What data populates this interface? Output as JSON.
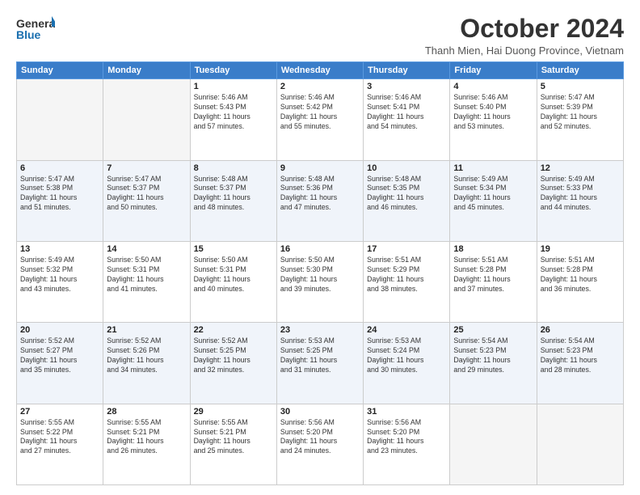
{
  "logo": {
    "line1": "General",
    "line2": "Blue"
  },
  "title": "October 2024",
  "subtitle": "Thanh Mien, Hai Duong Province, Vietnam",
  "days_of_week": [
    "Sunday",
    "Monday",
    "Tuesday",
    "Wednesday",
    "Thursday",
    "Friday",
    "Saturday"
  ],
  "weeks": [
    [
      {
        "day": "",
        "info": ""
      },
      {
        "day": "",
        "info": ""
      },
      {
        "day": "1",
        "info": "Sunrise: 5:46 AM\nSunset: 5:43 PM\nDaylight: 11 hours\nand 57 minutes."
      },
      {
        "day": "2",
        "info": "Sunrise: 5:46 AM\nSunset: 5:42 PM\nDaylight: 11 hours\nand 55 minutes."
      },
      {
        "day": "3",
        "info": "Sunrise: 5:46 AM\nSunset: 5:41 PM\nDaylight: 11 hours\nand 54 minutes."
      },
      {
        "day": "4",
        "info": "Sunrise: 5:46 AM\nSunset: 5:40 PM\nDaylight: 11 hours\nand 53 minutes."
      },
      {
        "day": "5",
        "info": "Sunrise: 5:47 AM\nSunset: 5:39 PM\nDaylight: 11 hours\nand 52 minutes."
      }
    ],
    [
      {
        "day": "6",
        "info": "Sunrise: 5:47 AM\nSunset: 5:38 PM\nDaylight: 11 hours\nand 51 minutes."
      },
      {
        "day": "7",
        "info": "Sunrise: 5:47 AM\nSunset: 5:37 PM\nDaylight: 11 hours\nand 50 minutes."
      },
      {
        "day": "8",
        "info": "Sunrise: 5:48 AM\nSunset: 5:37 PM\nDaylight: 11 hours\nand 48 minutes."
      },
      {
        "day": "9",
        "info": "Sunrise: 5:48 AM\nSunset: 5:36 PM\nDaylight: 11 hours\nand 47 minutes."
      },
      {
        "day": "10",
        "info": "Sunrise: 5:48 AM\nSunset: 5:35 PM\nDaylight: 11 hours\nand 46 minutes."
      },
      {
        "day": "11",
        "info": "Sunrise: 5:49 AM\nSunset: 5:34 PM\nDaylight: 11 hours\nand 45 minutes."
      },
      {
        "day": "12",
        "info": "Sunrise: 5:49 AM\nSunset: 5:33 PM\nDaylight: 11 hours\nand 44 minutes."
      }
    ],
    [
      {
        "day": "13",
        "info": "Sunrise: 5:49 AM\nSunset: 5:32 PM\nDaylight: 11 hours\nand 43 minutes."
      },
      {
        "day": "14",
        "info": "Sunrise: 5:50 AM\nSunset: 5:31 PM\nDaylight: 11 hours\nand 41 minutes."
      },
      {
        "day": "15",
        "info": "Sunrise: 5:50 AM\nSunset: 5:31 PM\nDaylight: 11 hours\nand 40 minutes."
      },
      {
        "day": "16",
        "info": "Sunrise: 5:50 AM\nSunset: 5:30 PM\nDaylight: 11 hours\nand 39 minutes."
      },
      {
        "day": "17",
        "info": "Sunrise: 5:51 AM\nSunset: 5:29 PM\nDaylight: 11 hours\nand 38 minutes."
      },
      {
        "day": "18",
        "info": "Sunrise: 5:51 AM\nSunset: 5:28 PM\nDaylight: 11 hours\nand 37 minutes."
      },
      {
        "day": "19",
        "info": "Sunrise: 5:51 AM\nSunset: 5:28 PM\nDaylight: 11 hours\nand 36 minutes."
      }
    ],
    [
      {
        "day": "20",
        "info": "Sunrise: 5:52 AM\nSunset: 5:27 PM\nDaylight: 11 hours\nand 35 minutes."
      },
      {
        "day": "21",
        "info": "Sunrise: 5:52 AM\nSunset: 5:26 PM\nDaylight: 11 hours\nand 34 minutes."
      },
      {
        "day": "22",
        "info": "Sunrise: 5:52 AM\nSunset: 5:25 PM\nDaylight: 11 hours\nand 32 minutes."
      },
      {
        "day": "23",
        "info": "Sunrise: 5:53 AM\nSunset: 5:25 PM\nDaylight: 11 hours\nand 31 minutes."
      },
      {
        "day": "24",
        "info": "Sunrise: 5:53 AM\nSunset: 5:24 PM\nDaylight: 11 hours\nand 30 minutes."
      },
      {
        "day": "25",
        "info": "Sunrise: 5:54 AM\nSunset: 5:23 PM\nDaylight: 11 hours\nand 29 minutes."
      },
      {
        "day": "26",
        "info": "Sunrise: 5:54 AM\nSunset: 5:23 PM\nDaylight: 11 hours\nand 28 minutes."
      }
    ],
    [
      {
        "day": "27",
        "info": "Sunrise: 5:55 AM\nSunset: 5:22 PM\nDaylight: 11 hours\nand 27 minutes."
      },
      {
        "day": "28",
        "info": "Sunrise: 5:55 AM\nSunset: 5:21 PM\nDaylight: 11 hours\nand 26 minutes."
      },
      {
        "day": "29",
        "info": "Sunrise: 5:55 AM\nSunset: 5:21 PM\nDaylight: 11 hours\nand 25 minutes."
      },
      {
        "day": "30",
        "info": "Sunrise: 5:56 AM\nSunset: 5:20 PM\nDaylight: 11 hours\nand 24 minutes."
      },
      {
        "day": "31",
        "info": "Sunrise: 5:56 AM\nSunset: 5:20 PM\nDaylight: 11 hours\nand 23 minutes."
      },
      {
        "day": "",
        "info": ""
      },
      {
        "day": "",
        "info": ""
      }
    ]
  ]
}
